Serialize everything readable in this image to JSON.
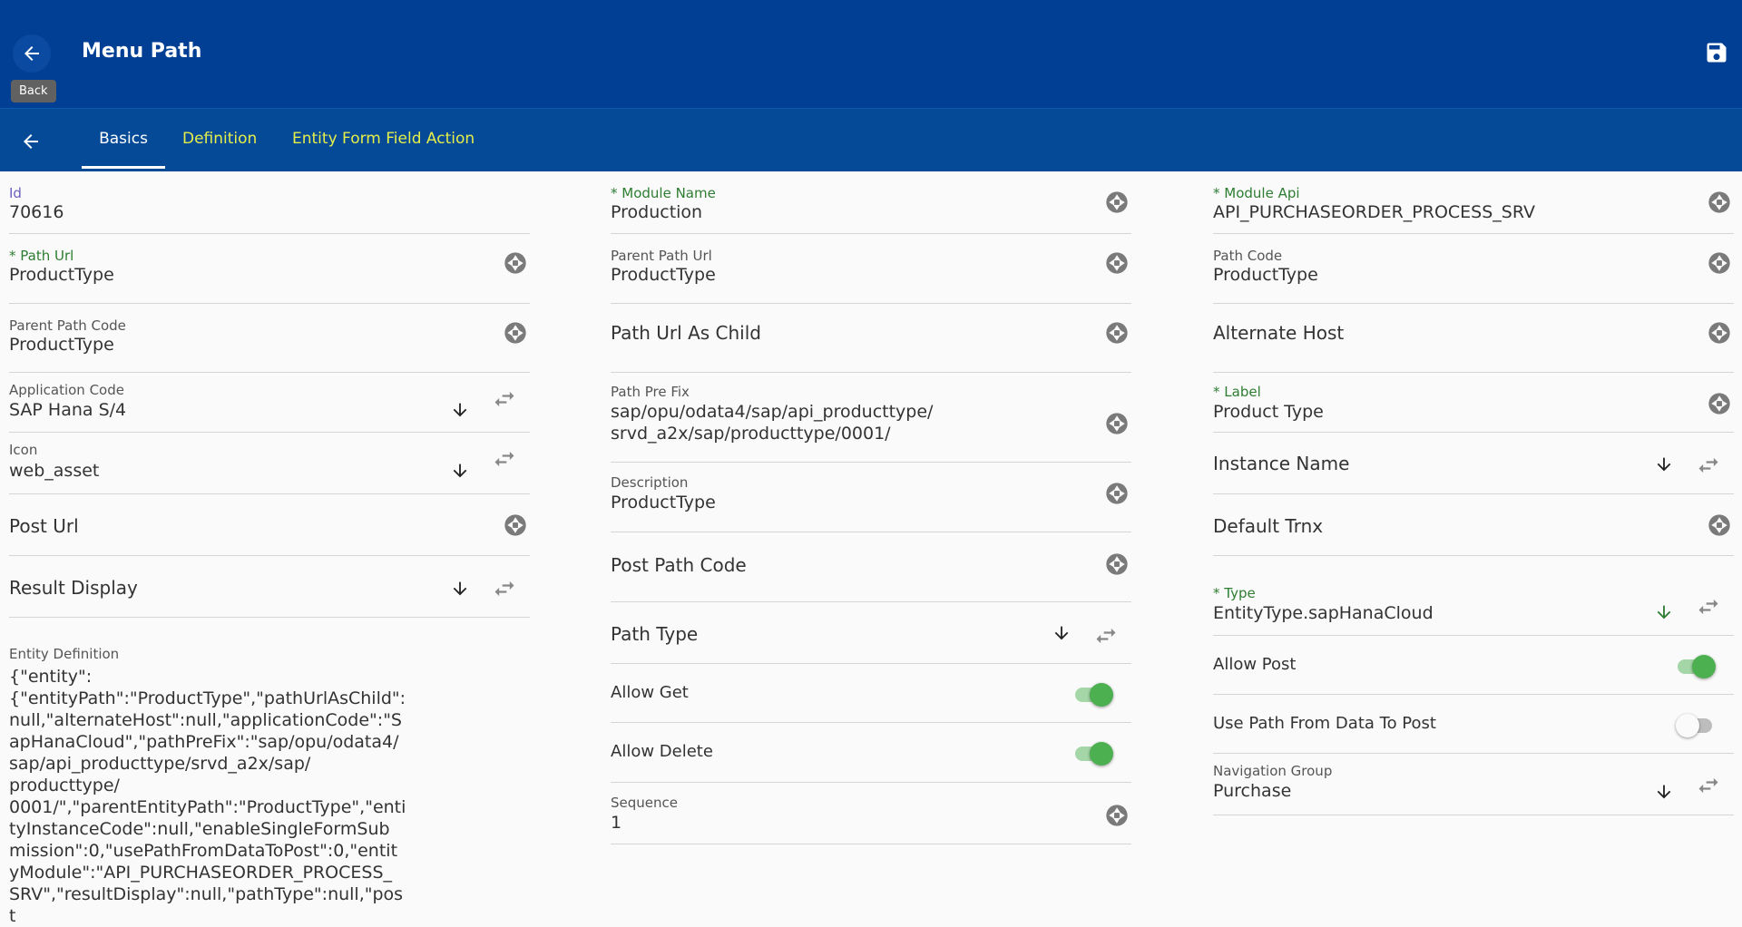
{
  "header": {
    "title": "Menu Path",
    "back_tooltip": "Back"
  },
  "tabs": [
    {
      "label": "Basics"
    },
    {
      "label": "Definition"
    },
    {
      "label": "Entity Form Field Action"
    }
  ],
  "left": {
    "id": {
      "label": "Id",
      "value": "70616"
    },
    "path_url": {
      "label": "* Path Url",
      "value": "ProductType"
    },
    "parent_path_code": {
      "label": "Parent Path Code",
      "value": "ProductType"
    },
    "application_code": {
      "label": "Application Code",
      "value": "SAP Hana S/4"
    },
    "icon": {
      "label": "Icon",
      "value": "web_asset"
    },
    "post_url": {
      "label": "Post Url"
    },
    "result_display": {
      "label": "Result Display"
    },
    "entity_definition": {
      "label": "Entity Definition",
      "value": "{\"entity\":\n{\"entityPath\":\"ProductType\",\"pathUrlAsChild\":\nnull,\"alternateHost\":null,\"applicationCode\":\"S\napHanaCloud\",\"pathPreFix\":\"sap/opu/odata4/\nsap/api_producttype/srvd_a2x/sap/\nproducttype/\n0001/\",\"parentEntityPath\":\"ProductType\",\"enti\ntyInstanceCode\":null,\"enableSingleFormSub\nmission\":0,\"usePathFromDataToPost\":0,\"entit\nyModule\":\"API_PURCHASEORDER_PROCESS_\nSRV\",\"resultDisplay\":null,\"pathType\":null,\"post"
    }
  },
  "middle": {
    "module_name": {
      "label": "* Module Name",
      "value": "Production"
    },
    "parent_path_url": {
      "label": "Parent Path Url",
      "value": "ProductType"
    },
    "path_url_as_child": {
      "label": "Path Url As Child"
    },
    "path_pre_fix": {
      "label": "Path Pre Fix",
      "value": "sap/opu/odata4/sap/api_producttype/\nsrvd_a2x/sap/producttype/0001/"
    },
    "description": {
      "label": "Description",
      "value": "ProductType"
    },
    "post_path_code": {
      "label": "Post Path Code"
    },
    "path_type": {
      "label": "Path Type"
    },
    "allow_get": {
      "label": "Allow Get",
      "on": true
    },
    "allow_delete": {
      "label": "Allow Delete",
      "on": true
    },
    "sequence": {
      "label": "Sequence",
      "value": "1"
    }
  },
  "right": {
    "module_api": {
      "label": "* Module Api",
      "value": "API_PURCHASEORDER_PROCESS_SRV"
    },
    "path_code": {
      "label": "Path Code",
      "value": "ProductType"
    },
    "alternate_host": {
      "label": "Alternate Host"
    },
    "label": {
      "label": "* Label",
      "value": "Product Type"
    },
    "instance_name": {
      "label": "Instance Name"
    },
    "default_trnx": {
      "label": "Default Trnx"
    },
    "type": {
      "label": "* Type",
      "value": "EntityType.sapHanaCloud"
    },
    "allow_post": {
      "label": "Allow Post",
      "on": true
    },
    "use_path_from_data_to_post": {
      "label": "Use Path From Data To Post",
      "on": false
    },
    "navigation_group": {
      "label": "Navigation Group",
      "value": "Purchase"
    }
  },
  "colors": {
    "header_bg": "#003f94",
    "tab_bg": "#044a96",
    "tab_inactive": "#e6ee4a",
    "required_label": "#2e7d32",
    "toggle_on": "#4caf50"
  }
}
